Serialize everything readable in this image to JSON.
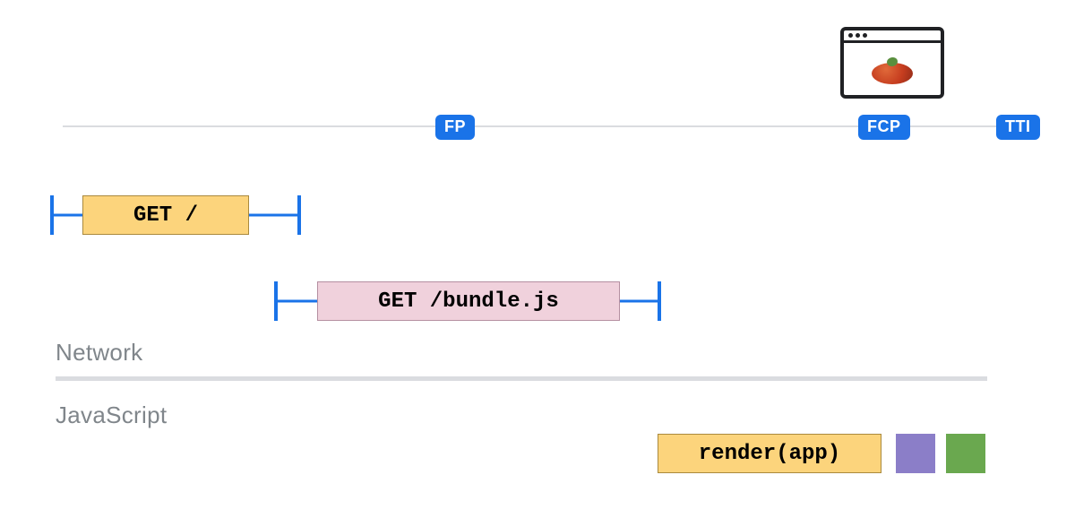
{
  "timeline": {
    "milestones": {
      "fp": "FP",
      "fcp": "FCP",
      "tti": "TTI"
    }
  },
  "requests": {
    "root": "GET /",
    "bundle": "GET /bundle.js"
  },
  "sections": {
    "network": "Network",
    "javascript": "JavaScript"
  },
  "js": {
    "render": "render(app)"
  },
  "icons": {
    "browser": "browser-window-icon",
    "content": "tomato-image"
  },
  "colors": {
    "accent_blue": "#1a73e8",
    "block_orange": "#fcd47c",
    "block_pink": "#f0d1dc",
    "block_purple": "#8b7ec8",
    "block_green": "#6aa84f"
  }
}
